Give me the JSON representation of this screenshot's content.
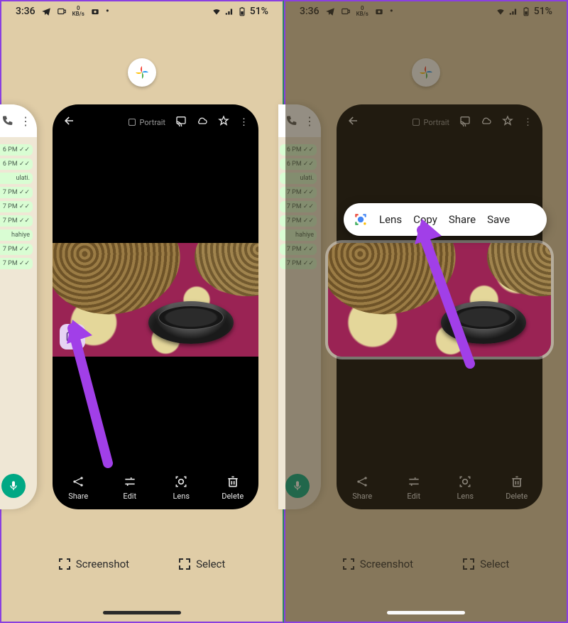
{
  "status": {
    "time": "3:36",
    "net_speed_top": "0",
    "net_speed_bottom": "KB/s",
    "battery_pct": "51%"
  },
  "photos_card": {
    "portrait_label": "Portrait",
    "actions": {
      "share": "Share",
      "edit": "Edit",
      "lens": "Lens",
      "delete": "Delete"
    }
  },
  "peek": {
    "bubbles": [
      "6 PM ✓✓",
      "6 PM ✓✓",
      "ulati.",
      "7 PM ✓✓",
      "7 PM ✓✓",
      "7 PM ✓✓",
      "hahiye",
      "7 PM ✓✓",
      "7 PM ✓✓"
    ]
  },
  "recents": {
    "screenshot": "Screenshot",
    "select": "Select"
  },
  "context_menu": {
    "lens": "Lens",
    "copy": "Copy",
    "share": "Share",
    "save": "Save"
  }
}
